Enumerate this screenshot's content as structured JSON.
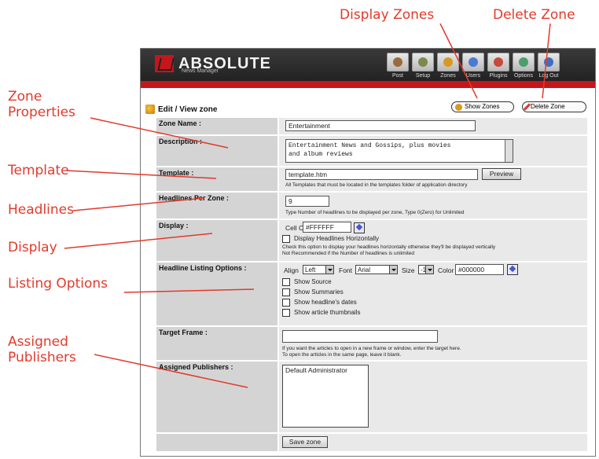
{
  "callouts": {
    "display_zones": "Display Zones",
    "delete_zone": "Delete Zone",
    "zone_properties_line1": "Zone",
    "zone_properties_line2": "Properties",
    "template": "Template",
    "headlines": "Headlines",
    "display": "Display",
    "listing_options": "Listing Options",
    "assigned_line1": "Assigned",
    "assigned_line2": "Publishers"
  },
  "app": {
    "logo": "ABSOLUTE",
    "logo_sub": "News Manager",
    "nav": [
      {
        "label": "Post",
        "color": "#9a6b3a"
      },
      {
        "label": "Setup",
        "color": "#7b8a4a"
      },
      {
        "label": "Zones",
        "color": "#d69a22"
      },
      {
        "label": "Users",
        "color": "#4b7bd1"
      },
      {
        "label": "Plugins",
        "color": "#c64a3a"
      },
      {
        "label": "Options",
        "color": "#4b9f6a"
      },
      {
        "label": "Log Out",
        "color": "#3c6fc4"
      }
    ]
  },
  "page": {
    "title": "Edit / View zone",
    "show_zones_button": "Show Zones",
    "delete_zone_button": "Delete Zone"
  },
  "form": {
    "zone_name_label": "Zone Name :",
    "zone_name_value": "Entertainment",
    "description_label": "Description :",
    "description_value_line1": "Entertainment News and Gossips, plus movies",
    "description_value_line2": "and album reviews",
    "template_label": "Template :",
    "template_value": "template.htm",
    "preview_button": "Preview",
    "template_note": "All Templates that must be located in the templates folder of application directory",
    "headlines_label": "Headlines Per Zone :",
    "headlines_value": "9",
    "headlines_note": "Type Number of headlines to be displayed per zone, Type 0(Zero) for Unlimited",
    "display_label": "Display :",
    "cell_color_label": "Cell Color",
    "cell_color_value": "#FFFFFF",
    "display_horizontal": "Display Headlines Horizontally",
    "display_note1": "Check this option to display your headlines horizontally otherwise they'll be displayed vertically",
    "display_note2": "Not Recommended if the Number of headlines is unlimited",
    "listing_label": "Headline Listing Options :",
    "align_label": "Align",
    "align_value": "Left",
    "font_label": "Font",
    "font_value": "Arial",
    "size_label": "Size",
    "size_value": "-1",
    "color_label": "Color",
    "color_value": "#000000",
    "show_source": "Show Source",
    "show_summaries": "Show Summaries",
    "show_dates": "Show headline's dates",
    "show_thumbnails": "Show article thumbnails",
    "target_label": "Target Frame :",
    "target_value": "",
    "target_note1": "If you want the articles to open in a new frame or window, enter the target here.",
    "target_note2": "To open the articles in the same page, leave it blank.",
    "publishers_label": "Assigned Publishers :",
    "publishers": [
      "Default Administrator"
    ],
    "save_button": "Save zone"
  },
  "colors": {
    "callout": "#e23a2c",
    "header_red": "#c5161c"
  }
}
